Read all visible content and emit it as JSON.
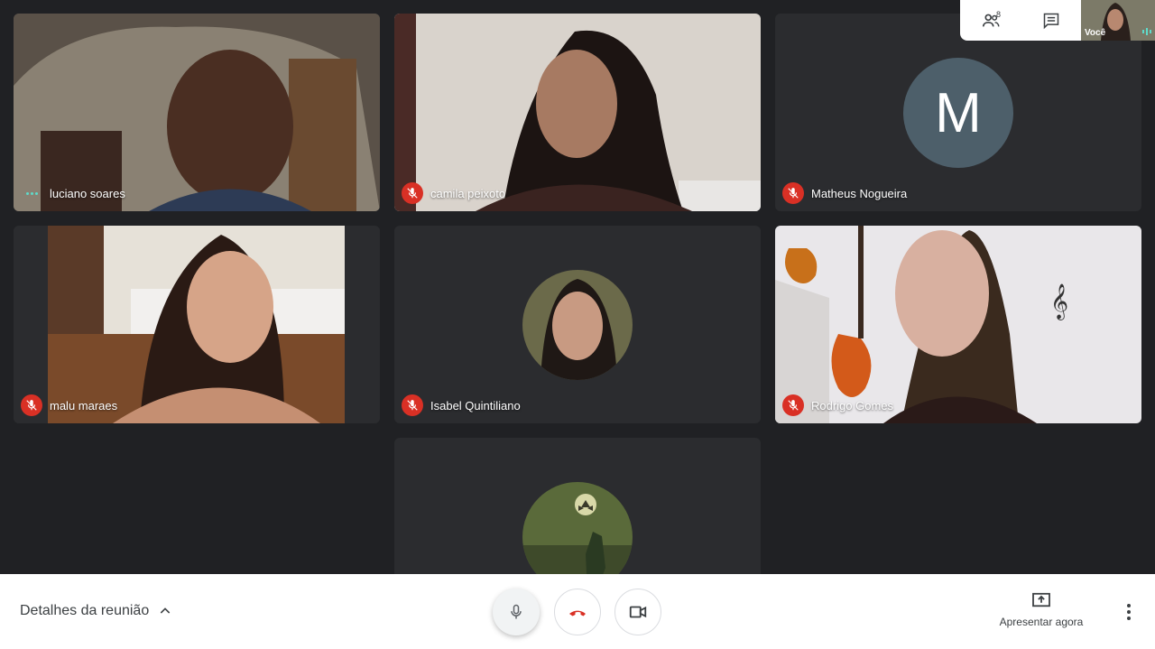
{
  "participants": [
    {
      "name": "luciano soares",
      "status": "speaking"
    },
    {
      "name": "camila peixoto",
      "status": "muted"
    },
    {
      "name": "Matheus Nogueira",
      "status": "muted",
      "avatar_letter": "M"
    },
    {
      "name": "malu maraes",
      "status": "muted"
    },
    {
      "name": "Isabel Quintiliano",
      "status": "muted"
    },
    {
      "name": "Rodrigo Gomes",
      "status": "muted"
    },
    {
      "name": "",
      "status": ""
    }
  ],
  "top_panel": {
    "participant_count": "8",
    "self_label": "Você"
  },
  "bottom_bar": {
    "details_label": "Detalhes da reunião",
    "present_label": "Apresentar agora"
  },
  "colors": {
    "mute_red": "#d93025",
    "speaking_teal": "#5fdaca",
    "avatar_bg": "#4d5f6a"
  }
}
